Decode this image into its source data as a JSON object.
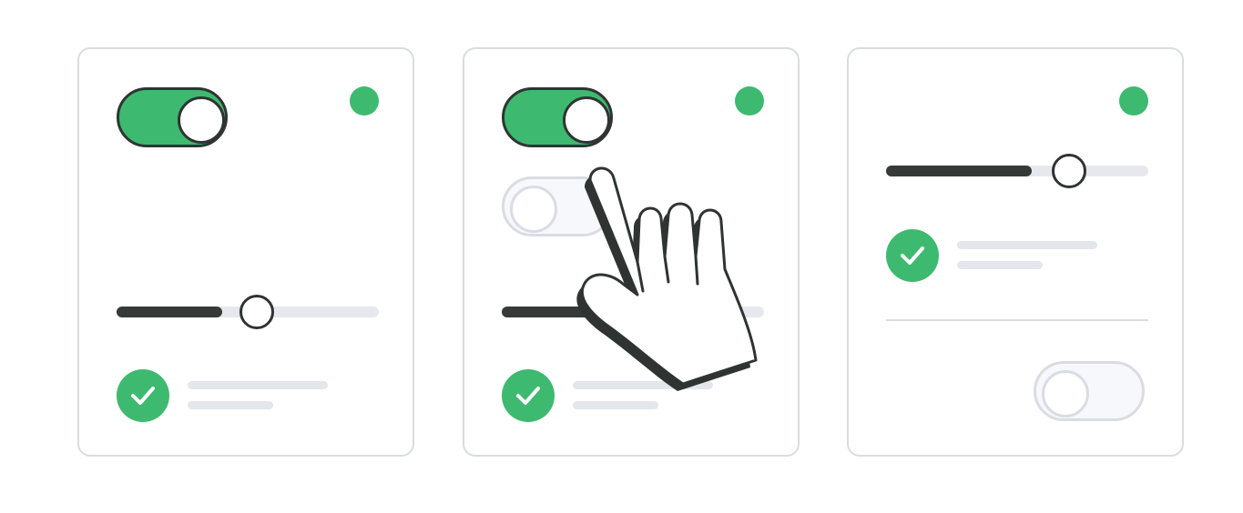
{
  "colors": {
    "accent": "#3dba6f",
    "dark": "#2f3433",
    "track": "#e6e8ed",
    "border": "#d9dce1"
  },
  "cards": [
    {
      "toggle_on": true,
      "slider_value": 0.4,
      "checked": true
    },
    {
      "toggle_on": true,
      "second_toggle_on": false,
      "slider_value": 0.4,
      "checked": true
    },
    {
      "slider_value": 0.55,
      "checked": true,
      "toggle_on": false
    }
  ],
  "icons": {
    "status": "status-dot-icon",
    "check": "checkmark-icon",
    "cursor": "pointer-hand-icon"
  }
}
